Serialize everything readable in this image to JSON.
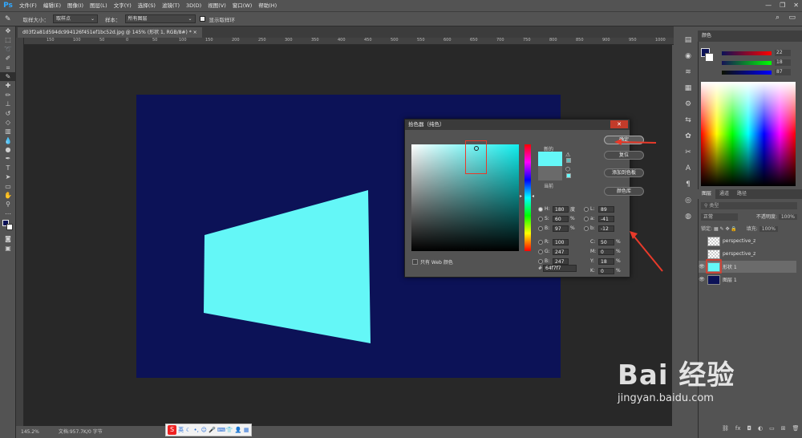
{
  "app": {
    "logo": "Ps"
  },
  "menu": [
    "文件(F)",
    "编辑(E)",
    "图像(I)",
    "图层(L)",
    "文字(Y)",
    "选择(S)",
    "滤镜(T)",
    "3D(D)",
    "视图(V)",
    "窗口(W)",
    "帮助(H)"
  ],
  "window_controls": {
    "minimize": "—",
    "maximize": "❐",
    "close": "✕"
  },
  "options_bar": {
    "tool_icon": "eyedropper-icon",
    "sample_size_label": "取样大小：",
    "sample_size_value": "取样点",
    "sample_label": "样本：",
    "sample_value": "所有图层",
    "show_ring_label": "显示取样环",
    "show_ring_checked": true
  },
  "document": {
    "tab_title": "d03f2a81d594dc994126f451ef1bc52d.jpg @ 145% (形状 1, RGB/8#) *",
    "background_color": "#0c1257",
    "shape_color": "#64f7f7",
    "zoom": "145.2%",
    "doc_info": "文档:957.7K/0 字节"
  },
  "ruler_ticks": [
    "150",
    "100",
    "50",
    "0",
    "50",
    "100",
    "150",
    "200",
    "250",
    "300",
    "350",
    "400",
    "450",
    "500",
    "550",
    "600",
    "650",
    "700",
    "750",
    "800",
    "850",
    "900",
    "950",
    "1000"
  ],
  "ime": {
    "lang": "英",
    "icons": [
      "moon-icon",
      "punct-icon",
      "emoji-icon",
      "mic-icon",
      "keyboard-icon",
      "shirt-icon",
      "user-icon",
      "grid-icon"
    ]
  },
  "color_panel": {
    "tab_label": "颜色",
    "fg": "#0c1257",
    "bg": "#ffffff",
    "values": [
      "22",
      "18",
      "87"
    ]
  },
  "layers_panel": {
    "tabs": [
      "图层",
      "通道",
      "路径"
    ],
    "search_placeholder": "类型",
    "blend_mode": "正常",
    "opacity_label": "不透明度:",
    "opacity_value": "100%",
    "lock_label": "锁定:",
    "fill_label": "填充:",
    "fill_value": "100%",
    "layers": [
      {
        "name": "perspective_z",
        "visible": false,
        "selected": false
      },
      {
        "name": "perspective_z",
        "visible": false,
        "selected": false
      },
      {
        "name": "形状 1",
        "visible": true,
        "selected": true
      },
      {
        "name": "图层 1",
        "visible": true,
        "selected": false
      }
    ]
  },
  "picker_dialog": {
    "title": "拾色器（纯色）",
    "close": "✕",
    "new_label": "新的",
    "current_label": "当前",
    "new_color": "#64f7f7",
    "current_color": "#6a6a6a",
    "buttons": {
      "ok": "确定",
      "reset": "复位",
      "add_swatch": "添加到色板",
      "color_libraries": "颜色库"
    },
    "web_only_label": "只有 Web 颜色",
    "fields_left": [
      {
        "key": "H:",
        "value": "180",
        "unit": "度",
        "selected": true
      },
      {
        "key": "S:",
        "value": "60",
        "unit": "%",
        "selected": false
      },
      {
        "key": "B:",
        "value": "97",
        "unit": "%",
        "selected": false
      },
      {
        "key": "R:",
        "value": "100",
        "unit": "",
        "selected": false
      },
      {
        "key": "G:",
        "value": "247",
        "unit": "",
        "selected": false
      },
      {
        "key": "B:",
        "value": "247",
        "unit": "",
        "selected": false
      }
    ],
    "fields_right": [
      {
        "key": "L:",
        "value": "89",
        "unit": ""
      },
      {
        "key": "a:",
        "value": "-41",
        "unit": ""
      },
      {
        "key": "b:",
        "value": "-12",
        "unit": ""
      },
      {
        "key": "C:",
        "value": "50",
        "unit": "%"
      },
      {
        "key": "M:",
        "value": "0",
        "unit": "%"
      },
      {
        "key": "Y:",
        "value": "18",
        "unit": "%"
      },
      {
        "key": "K:",
        "value": "0",
        "unit": "%"
      }
    ],
    "hex_label": "#",
    "hex_value": "64f7f7"
  },
  "watermark": {
    "main": "Bai 经验",
    "sub": "jingyan.baidu.com"
  }
}
